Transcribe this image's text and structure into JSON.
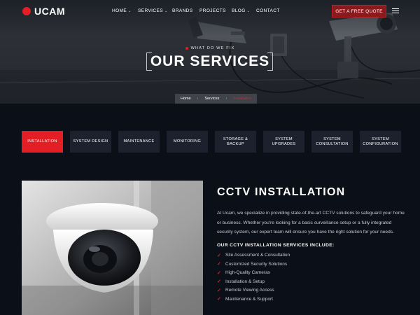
{
  "brand": {
    "logo_text": "UCAM"
  },
  "nav": {
    "items": [
      {
        "label": "HOME",
        "dropdown": true
      },
      {
        "label": "SERVICES",
        "dropdown": true
      },
      {
        "label": "BRANDS",
        "dropdown": false
      },
      {
        "label": "PROJECTS",
        "dropdown": false
      },
      {
        "label": "BLOG",
        "dropdown": true
      },
      {
        "label": "CONTACT",
        "dropdown": false
      }
    ],
    "cta_label": "GET A FREE QUOTE"
  },
  "hero": {
    "eyebrow": "WHAT DO WE FIX",
    "title": "OUR SERVICES"
  },
  "breadcrumb": {
    "home": "Home",
    "services": "Services",
    "current": "Installation"
  },
  "tabs": [
    {
      "label": "INSTALLATION",
      "active": true
    },
    {
      "label": "SYSTEM DESIGN",
      "active": false
    },
    {
      "label": "MAINTENANCE",
      "active": false
    },
    {
      "label": "MONITORING",
      "active": false
    },
    {
      "label": "STORAGE & BACKUP",
      "active": false
    },
    {
      "label": "SYSTEM UPGRADES",
      "active": false
    },
    {
      "label": "SYSTEM CONSULTATION",
      "active": false
    },
    {
      "label": "SYSTEM CONFIGURATION",
      "active": false
    }
  ],
  "main": {
    "title": "CCTV INSTALLATION",
    "description": "At Ucam, we specialize in providing state-of-the-art CCTV solutions to safeguard your home or business. Whether you're looking for a basic surveillance setup or a fully integrated security system, our expert team will ensure you have the right solution for your needs.",
    "services_heading": "OUR CCTV INSTALLATION SERVICES INCLUDE:",
    "services": [
      "Site Assessment & Consultation",
      "Customized Security Solutions",
      "High-Quality Cameras",
      "Installation & Setup",
      "Remote Viewing Access",
      "Maintenance & Support"
    ]
  },
  "colors": {
    "accent": "#e31e24",
    "background": "#0b0f17",
    "tab_bg": "#1b222e"
  }
}
